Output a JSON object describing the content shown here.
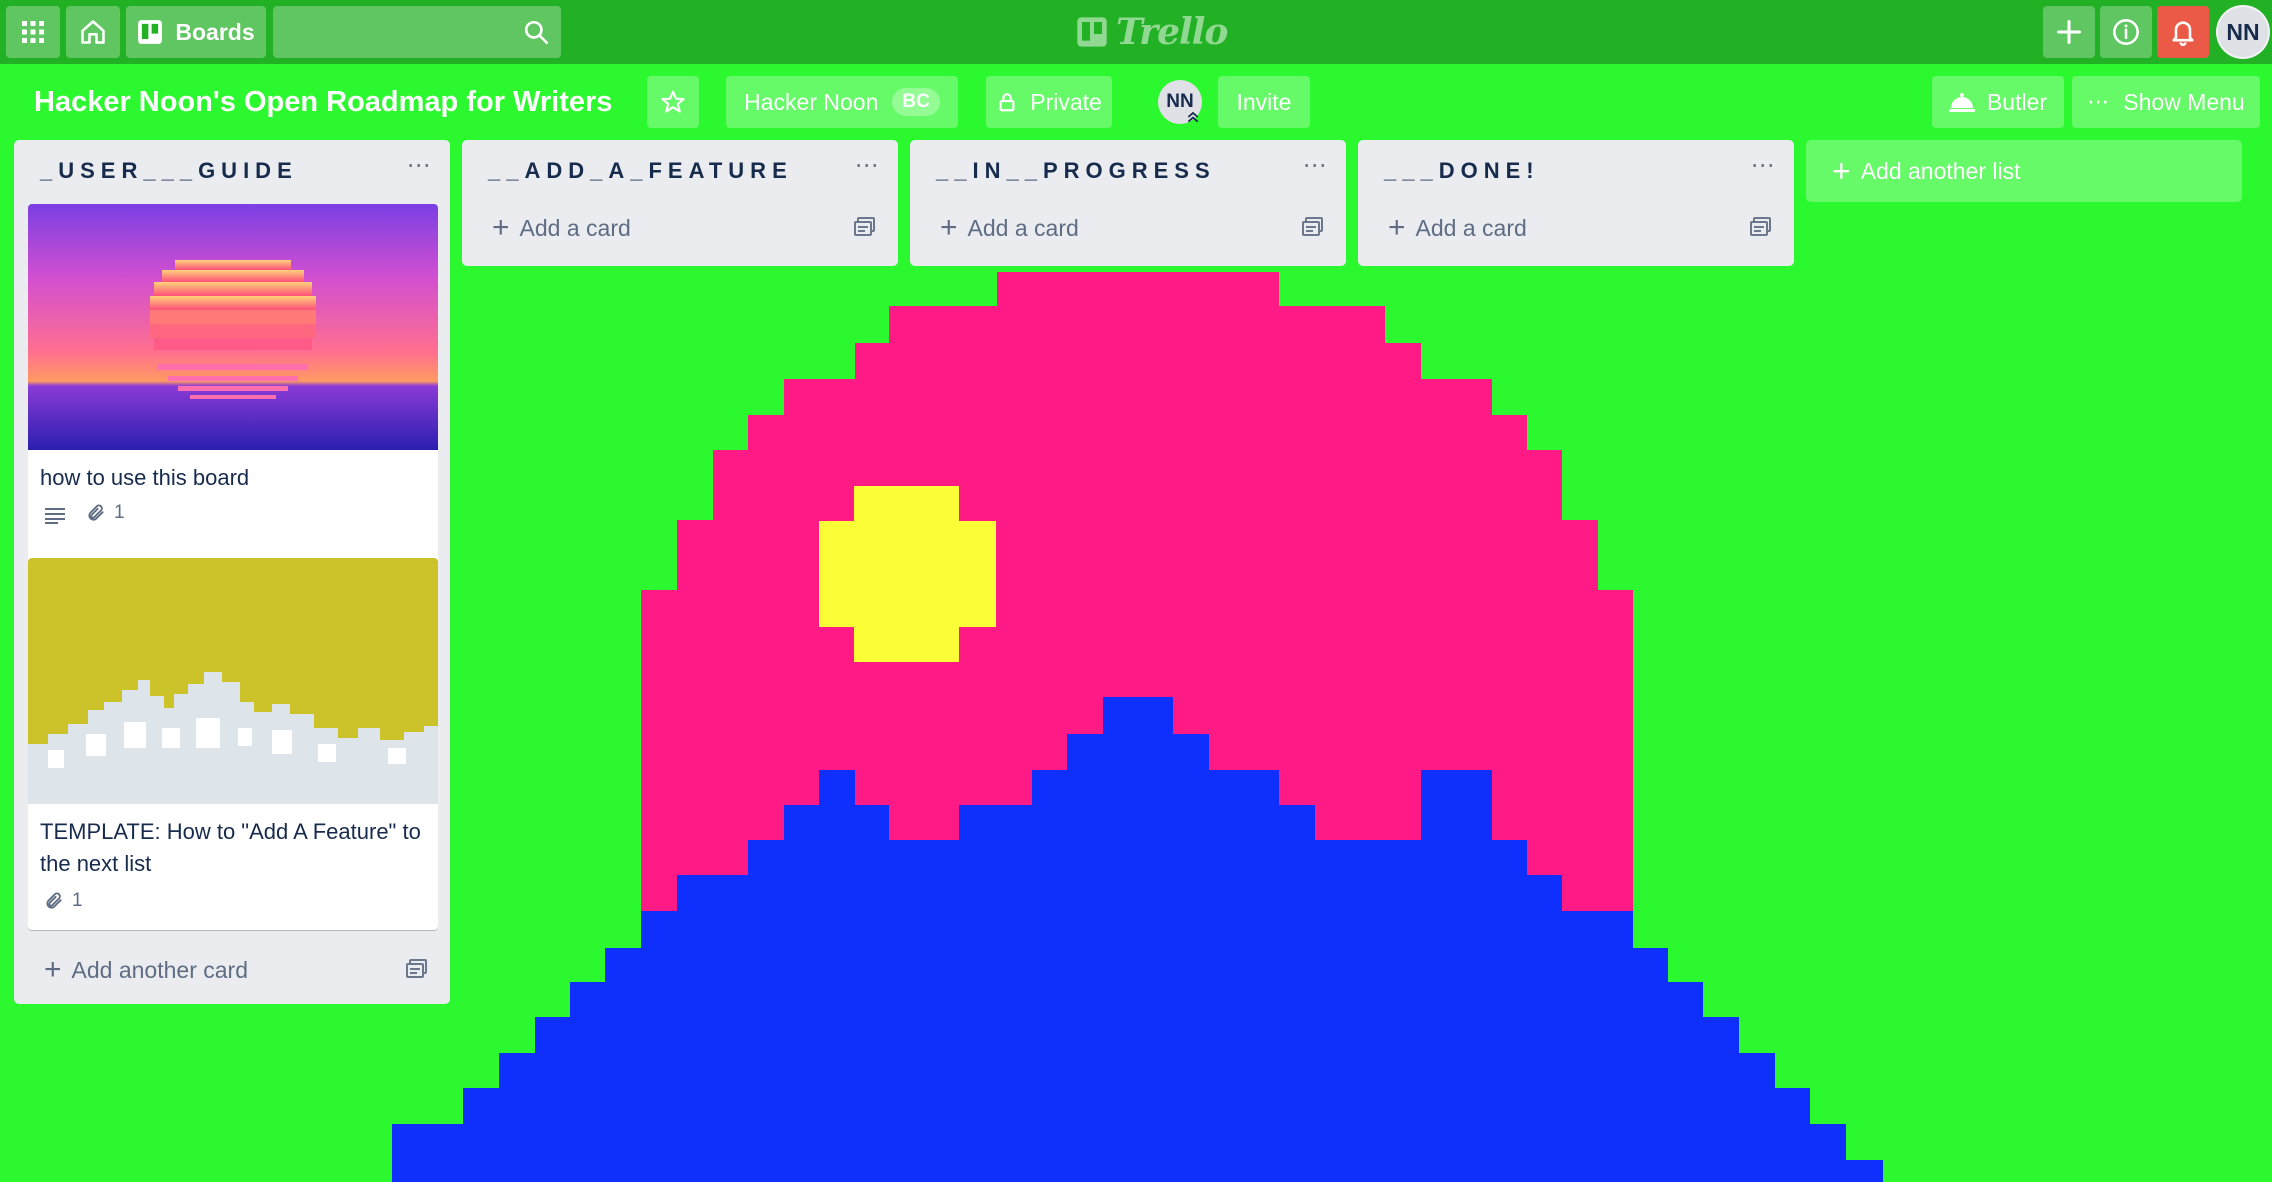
{
  "app": {
    "logo_text": "Trello",
    "boards_label": "Boards",
    "search_placeholder": "",
    "user_initials": "NN"
  },
  "board": {
    "title": "Hacker Noon's Open Roadmap for Writers",
    "team_name": "Hacker Noon",
    "team_badge": "BC",
    "visibility": "Private",
    "member_initials": "NN",
    "invite_label": "Invite",
    "butler_label": "Butler",
    "show_menu_label": "Show Menu",
    "menu_dots": "⋯"
  },
  "lists": [
    {
      "title": "_USER___GUIDE",
      "menu": "⋯",
      "cards": [
        {
          "title": "how to use this board",
          "has_description": true,
          "attachments": "1",
          "cover": "sunset"
        },
        {
          "title": "TEMPLATE: How to \"Add A Feature\" to the next list",
          "has_description": false,
          "attachments": "1",
          "cover": "mountains"
        }
      ],
      "add_label": "Add another card"
    },
    {
      "title": "__ADD_A_FEATURE",
      "menu": "⋯",
      "cards": [],
      "add_label": "Add a card"
    },
    {
      "title": "__IN__PROGRESS",
      "menu": "⋯",
      "cards": [],
      "add_label": "Add a card"
    },
    {
      "title": "___DONE!",
      "menu": "⋯",
      "cards": [],
      "add_label": "Add a card"
    }
  ],
  "add_list_label": "Add another list",
  "colors": {
    "board_bg": "#2cf82f",
    "art_pink": "#ff1a86",
    "art_blue": "#0f2ffd",
    "art_yellow": "#fbfe37",
    "notification_red": "#eb5a46"
  }
}
